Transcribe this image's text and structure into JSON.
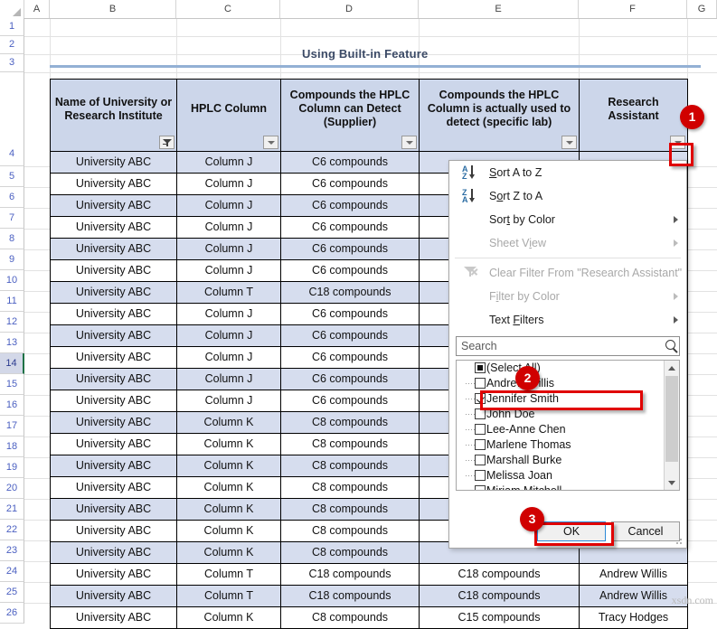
{
  "app": {
    "type": "spreadsheet",
    "title": "Using Built-in Feature"
  },
  "columns": [
    {
      "letter": "A"
    },
    {
      "letter": "B"
    },
    {
      "letter": "C"
    },
    {
      "letter": "D"
    },
    {
      "letter": "E"
    },
    {
      "letter": "F"
    },
    {
      "letter": "G"
    }
  ],
  "rows": [
    "1",
    "2",
    "3",
    "4",
    "5",
    "6",
    "7",
    "8",
    "9",
    "10",
    "11",
    "12",
    "13",
    "14",
    "15",
    "16",
    "17",
    "18",
    "19",
    "20",
    "21",
    "22",
    "23",
    "24",
    "25",
    "26"
  ],
  "selected_row": "14",
  "table": {
    "headers": [
      {
        "label": "Name of University or Research Institute",
        "filter_state": "filtered"
      },
      {
        "label": "HPLC Column",
        "filter_state": "normal"
      },
      {
        "label": "Compounds the HPLC Column can Detect (Supplier)",
        "filter_state": "normal"
      },
      {
        "label": "Compounds the HPLC Column is actually used to detect (specific lab)",
        "filter_state": "normal"
      },
      {
        "label": "Research Assistant",
        "filter_state": "normal"
      }
    ],
    "rows": [
      [
        "University ABC",
        "Column J",
        "C6 compounds",
        "",
        ""
      ],
      [
        "University ABC",
        "Column J",
        "C6 compounds",
        "",
        ""
      ],
      [
        "University ABC",
        "Column J",
        "C6 compounds",
        "",
        ""
      ],
      [
        "University ABC",
        "Column J",
        "C6 compounds",
        "",
        ""
      ],
      [
        "University ABC",
        "Column J",
        "C6 compounds",
        "",
        ""
      ],
      [
        "University ABC",
        "Column J",
        "C6 compounds",
        "",
        ""
      ],
      [
        "University ABC",
        "Column T",
        "C18 compounds",
        "",
        ""
      ],
      [
        "University ABC",
        "Column J",
        "C6 compounds",
        "",
        ""
      ],
      [
        "University ABC",
        "Column J",
        "C6 compounds",
        "",
        ""
      ],
      [
        "University ABC",
        "Column J",
        "C6 compounds",
        "",
        ""
      ],
      [
        "University ABC",
        "Column J",
        "C6 compounds",
        "",
        ""
      ],
      [
        "University ABC",
        "Column J",
        "C6 compounds",
        "",
        ""
      ],
      [
        "University ABC",
        "Column K",
        "C8 compounds",
        "",
        ""
      ],
      [
        "University ABC",
        "Column K",
        "C8 compounds",
        "",
        ""
      ],
      [
        "University ABC",
        "Column K",
        "C8 compounds",
        "",
        ""
      ],
      [
        "University ABC",
        "Column K",
        "C8 compounds",
        "",
        ""
      ],
      [
        "University ABC",
        "Column K",
        "C8 compounds",
        "",
        ""
      ],
      [
        "University ABC",
        "Column K",
        "C8 compounds",
        "",
        ""
      ],
      [
        "University ABC",
        "Column K",
        "C8 compounds",
        "",
        ""
      ],
      [
        "University ABC",
        "Column T",
        "C18 compounds",
        "C18 compounds",
        "Andrew Willis"
      ],
      [
        "University ABC",
        "Column T",
        "C18 compounds",
        "C18 compounds",
        "Andrew Willis"
      ],
      [
        "University ABC",
        "Column K",
        "C8 compounds",
        "C15 compounds",
        "Tracy Hodges"
      ]
    ]
  },
  "filter_menu": {
    "items": [
      {
        "label": "Sort A to Z",
        "icon": "sort-az-icon",
        "disabled": false,
        "submenu": false
      },
      {
        "label": "Sort Z to A",
        "icon": "sort-za-icon",
        "disabled": false,
        "submenu": false
      },
      {
        "label": "Sort by Color",
        "icon": "",
        "disabled": false,
        "submenu": true
      },
      {
        "label": "Sheet View",
        "icon": "",
        "disabled": true,
        "submenu": true
      },
      {
        "label": "Clear Filter From \"Research Assistant\"",
        "icon": "clear-filter-icon",
        "disabled": true,
        "submenu": false
      },
      {
        "label": "Filter by Color",
        "icon": "",
        "disabled": true,
        "submenu": true
      },
      {
        "label": "Text Filters",
        "icon": "",
        "disabled": false,
        "submenu": true
      }
    ],
    "search": {
      "placeholder": "Search",
      "value": "",
      "icon": "search-icon"
    },
    "list": [
      {
        "label": "(Select All)",
        "state": "partial"
      },
      {
        "label": "Andrew Willis",
        "state": "unchecked"
      },
      {
        "label": "Jennifer Smith",
        "state": "checked"
      },
      {
        "label": "John Doe",
        "state": "unchecked"
      },
      {
        "label": "Lee-Anne Chen",
        "state": "unchecked"
      },
      {
        "label": "Marlene Thomas",
        "state": "unchecked"
      },
      {
        "label": "Marshall Burke",
        "state": "unchecked"
      },
      {
        "label": "Melissa Joan",
        "state": "unchecked"
      },
      {
        "label": "Miriam Mitchell",
        "state": "unchecked"
      }
    ],
    "buttons": {
      "ok": "OK",
      "cancel": "Cancel"
    }
  },
  "annotations": {
    "badges": [
      "1",
      "2",
      "3"
    ]
  },
  "watermark": "xsdn.com",
  "colors": {
    "header_fill": "#ccd6ea",
    "alt_row_fill": "#d6ddee",
    "accent_rule": "#93b0d4",
    "callout_red": "#d00000",
    "title_text": "#3b4a66"
  }
}
